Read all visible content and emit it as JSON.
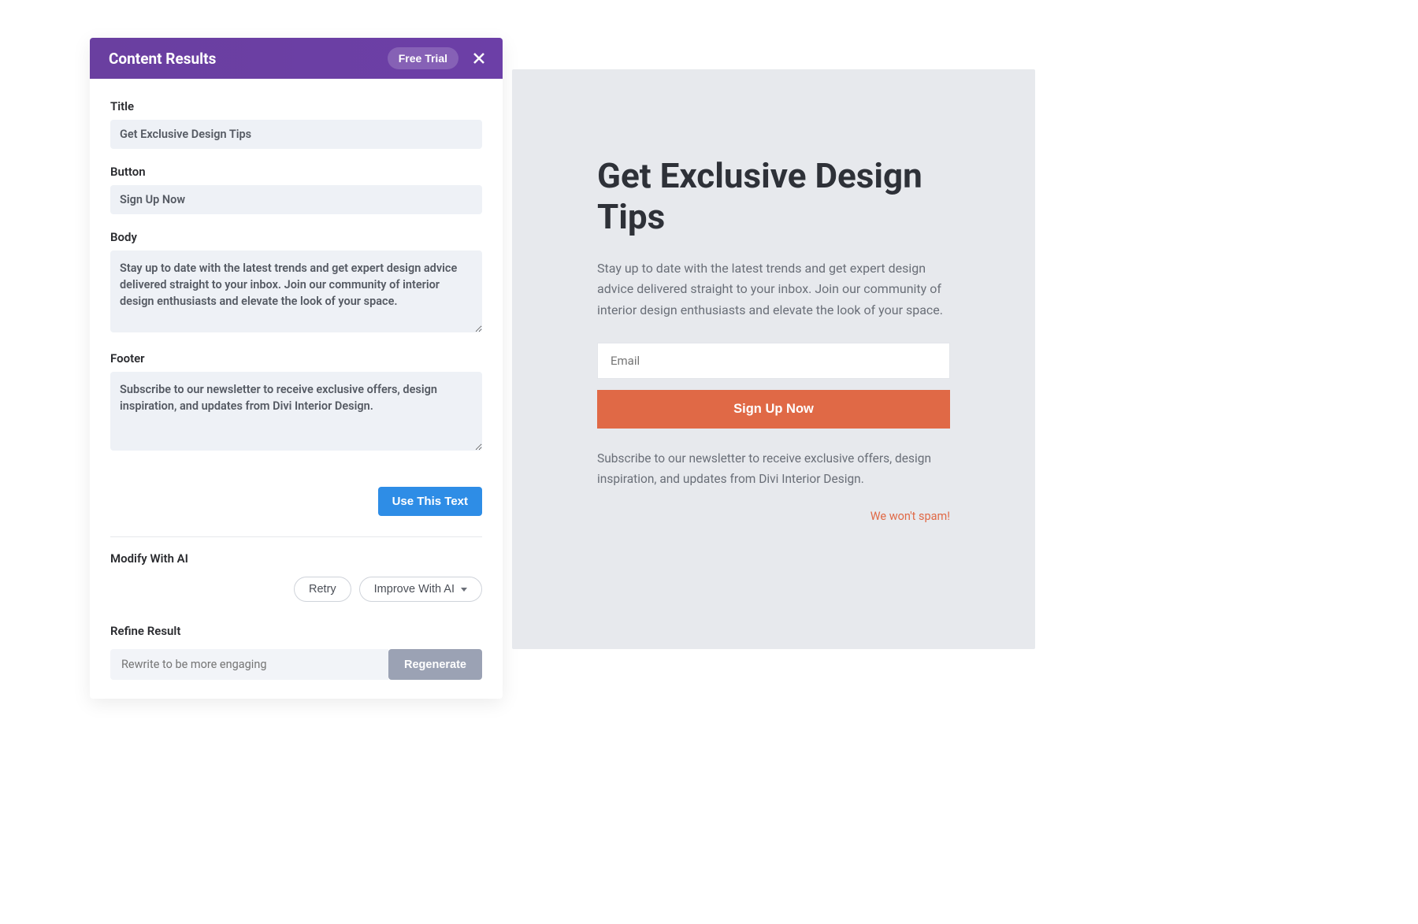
{
  "panel": {
    "header": {
      "title": "Content Results",
      "trial_label": "Free Trial"
    },
    "fields": {
      "title_label": "Title",
      "title_value": "Get Exclusive Design Tips",
      "button_label": "Button",
      "button_value": "Sign Up Now",
      "body_label": "Body",
      "body_value": "Stay up to date with the latest trends and get expert design advice delivered straight to your inbox. Join our community of interior design enthusiasts and elevate the look of your space.",
      "footer_label": "Footer",
      "footer_value": "Subscribe to our newsletter to receive exclusive offers, design inspiration, and updates from Divi Interior Design."
    },
    "actions": {
      "use_text": "Use This Text",
      "modify_label": "Modify With AI",
      "retry": "Retry",
      "improve": "Improve With AI",
      "refine_label": "Refine Result",
      "refine_placeholder": "Rewrite to be more engaging",
      "regenerate": "Regenerate"
    }
  },
  "preview": {
    "title": "Get Exclusive Design Tips",
    "body": "Stay up to date with the latest trends and get expert design advice delivered straight to your inbox. Join our community of interior design enthusiasts and elevate the look of your space.",
    "email_placeholder": "Email",
    "button": "Sign Up Now",
    "footer": "Subscribe to our newsletter to receive exclusive offers, design inspiration, and updates from Divi Interior Design.",
    "spam_note": "We won't spam!"
  }
}
